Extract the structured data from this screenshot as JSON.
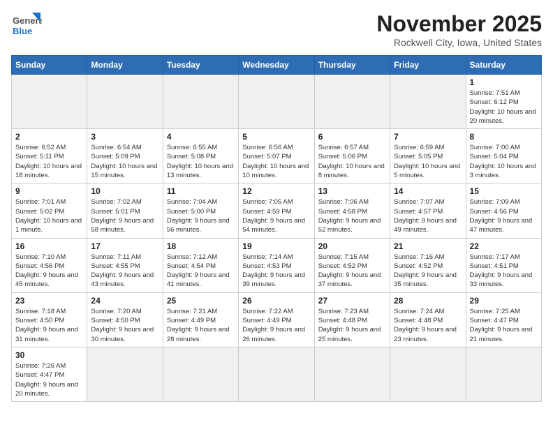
{
  "logo": {
    "text_general": "General",
    "text_blue": "Blue"
  },
  "header": {
    "month": "November 2025",
    "location": "Rockwell City, Iowa, United States"
  },
  "weekdays": [
    "Sunday",
    "Monday",
    "Tuesday",
    "Wednesday",
    "Thursday",
    "Friday",
    "Saturday"
  ],
  "weeks": [
    [
      {
        "day": "",
        "info": "",
        "empty": true
      },
      {
        "day": "",
        "info": "",
        "empty": true
      },
      {
        "day": "",
        "info": "",
        "empty": true
      },
      {
        "day": "",
        "info": "",
        "empty": true
      },
      {
        "day": "",
        "info": "",
        "empty": true
      },
      {
        "day": "",
        "info": "",
        "empty": true
      },
      {
        "day": "1",
        "info": "Sunrise: 7:51 AM\nSunset: 6:12 PM\nDaylight: 10 hours and 20 minutes.",
        "empty": false
      }
    ],
    [
      {
        "day": "2",
        "info": "Sunrise: 6:52 AM\nSunset: 5:11 PM\nDaylight: 10 hours and 18 minutes.",
        "empty": false
      },
      {
        "day": "3",
        "info": "Sunrise: 6:54 AM\nSunset: 5:09 PM\nDaylight: 10 hours and 15 minutes.",
        "empty": false
      },
      {
        "day": "4",
        "info": "Sunrise: 6:55 AM\nSunset: 5:08 PM\nDaylight: 10 hours and 13 minutes.",
        "empty": false
      },
      {
        "day": "5",
        "info": "Sunrise: 6:56 AM\nSunset: 5:07 PM\nDaylight: 10 hours and 10 minutes.",
        "empty": false
      },
      {
        "day": "6",
        "info": "Sunrise: 6:57 AM\nSunset: 5:06 PM\nDaylight: 10 hours and 8 minutes.",
        "empty": false
      },
      {
        "day": "7",
        "info": "Sunrise: 6:59 AM\nSunset: 5:05 PM\nDaylight: 10 hours and 5 minutes.",
        "empty": false
      },
      {
        "day": "8",
        "info": "Sunrise: 7:00 AM\nSunset: 5:04 PM\nDaylight: 10 hours and 3 minutes.",
        "empty": false
      }
    ],
    [
      {
        "day": "9",
        "info": "Sunrise: 7:01 AM\nSunset: 5:02 PM\nDaylight: 10 hours and 1 minute.",
        "empty": false
      },
      {
        "day": "10",
        "info": "Sunrise: 7:02 AM\nSunset: 5:01 PM\nDaylight: 9 hours and 58 minutes.",
        "empty": false
      },
      {
        "day": "11",
        "info": "Sunrise: 7:04 AM\nSunset: 5:00 PM\nDaylight: 9 hours and 56 minutes.",
        "empty": false
      },
      {
        "day": "12",
        "info": "Sunrise: 7:05 AM\nSunset: 4:59 PM\nDaylight: 9 hours and 54 minutes.",
        "empty": false
      },
      {
        "day": "13",
        "info": "Sunrise: 7:06 AM\nSunset: 4:58 PM\nDaylight: 9 hours and 52 minutes.",
        "empty": false
      },
      {
        "day": "14",
        "info": "Sunrise: 7:07 AM\nSunset: 4:57 PM\nDaylight: 9 hours and 49 minutes.",
        "empty": false
      },
      {
        "day": "15",
        "info": "Sunrise: 7:09 AM\nSunset: 4:56 PM\nDaylight: 9 hours and 47 minutes.",
        "empty": false
      }
    ],
    [
      {
        "day": "16",
        "info": "Sunrise: 7:10 AM\nSunset: 4:56 PM\nDaylight: 9 hours and 45 minutes.",
        "empty": false
      },
      {
        "day": "17",
        "info": "Sunrise: 7:11 AM\nSunset: 4:55 PM\nDaylight: 9 hours and 43 minutes.",
        "empty": false
      },
      {
        "day": "18",
        "info": "Sunrise: 7:12 AM\nSunset: 4:54 PM\nDaylight: 9 hours and 41 minutes.",
        "empty": false
      },
      {
        "day": "19",
        "info": "Sunrise: 7:14 AM\nSunset: 4:53 PM\nDaylight: 9 hours and 39 minutes.",
        "empty": false
      },
      {
        "day": "20",
        "info": "Sunrise: 7:15 AM\nSunset: 4:52 PM\nDaylight: 9 hours and 37 minutes.",
        "empty": false
      },
      {
        "day": "21",
        "info": "Sunrise: 7:16 AM\nSunset: 4:52 PM\nDaylight: 9 hours and 35 minutes.",
        "empty": false
      },
      {
        "day": "22",
        "info": "Sunrise: 7:17 AM\nSunset: 4:51 PM\nDaylight: 9 hours and 33 minutes.",
        "empty": false
      }
    ],
    [
      {
        "day": "23",
        "info": "Sunrise: 7:18 AM\nSunset: 4:50 PM\nDaylight: 9 hours and 31 minutes.",
        "empty": false
      },
      {
        "day": "24",
        "info": "Sunrise: 7:20 AM\nSunset: 4:50 PM\nDaylight: 9 hours and 30 minutes.",
        "empty": false
      },
      {
        "day": "25",
        "info": "Sunrise: 7:21 AM\nSunset: 4:49 PM\nDaylight: 9 hours and 28 minutes.",
        "empty": false
      },
      {
        "day": "26",
        "info": "Sunrise: 7:22 AM\nSunset: 4:49 PM\nDaylight: 9 hours and 26 minutes.",
        "empty": false
      },
      {
        "day": "27",
        "info": "Sunrise: 7:23 AM\nSunset: 4:48 PM\nDaylight: 9 hours and 25 minutes.",
        "empty": false
      },
      {
        "day": "28",
        "info": "Sunrise: 7:24 AM\nSunset: 4:48 PM\nDaylight: 9 hours and 23 minutes.",
        "empty": false
      },
      {
        "day": "29",
        "info": "Sunrise: 7:25 AM\nSunset: 4:47 PM\nDaylight: 9 hours and 21 minutes.",
        "empty": false
      }
    ],
    [
      {
        "day": "30",
        "info": "Sunrise: 7:26 AM\nSunset: 4:47 PM\nDaylight: 9 hours and 20 minutes.",
        "empty": false
      },
      {
        "day": "",
        "info": "",
        "empty": true
      },
      {
        "day": "",
        "info": "",
        "empty": true
      },
      {
        "day": "",
        "info": "",
        "empty": true
      },
      {
        "day": "",
        "info": "",
        "empty": true
      },
      {
        "day": "",
        "info": "",
        "empty": true
      },
      {
        "day": "",
        "info": "",
        "empty": true
      }
    ]
  ]
}
